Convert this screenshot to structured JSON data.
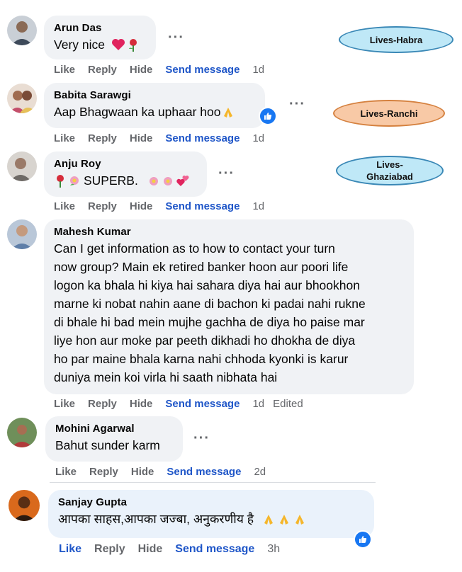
{
  "actions": {
    "like": "Like",
    "reply": "Reply",
    "hide": "Hide",
    "send": "Send message",
    "edited": "Edited"
  },
  "tags": [
    "Lives-Habra",
    "Lives-Ranchi",
    "Lives-Ghaziabad"
  ],
  "tag3_lines": [
    "Lives-",
    "Ghaziabad"
  ],
  "comments": [
    {
      "name": "Arun Das",
      "text": "Very nice",
      "time": "1d",
      "emoji": [
        "red-heart",
        "rose"
      ]
    },
    {
      "name": "Babita Sarawgi",
      "text": "Aap Bhagwaan ka uphaar hoo",
      "time": "1d",
      "emoji": [
        "folded-hands"
      ],
      "reaction": "like"
    },
    {
      "name": "Anju Roy",
      "text": "SUPERB.",
      "time": "1d",
      "emoji": [
        "rose",
        "flowers",
        "flowers",
        "flowers",
        "hearts"
      ]
    },
    {
      "name": "Mahesh Kumar",
      "lines": [
        "Can I get information as to how to contact your turn",
        "now group? Main ek retired banker hoon aur poori life",
        "logon ka bhala hi kiya hai sahara diya hai aur bhookhon",
        "marne ki nobat nahin aane di bachon ki padai nahi rukne",
        "di bhale hi bad mein mujhe gachha de diya ho paise mar",
        "liye hon aur moke par peeth dikhadi ho dhokha de diya",
        "ho par maine bhala karna nahi chhoda kyonki is karur",
        "duniya mein koi virla hi saath nibhata hai"
      ],
      "time": "1d",
      "edited": true
    },
    {
      "name": "Mohini Agarwal",
      "text": "Bahut sunder karm",
      "time": "2d"
    },
    {
      "name": "Sanjay Gupta",
      "text": "आपका साहस,आपका जज्बा, अनुकरणीय है",
      "time": "3h",
      "emoji": [
        "folded-hands",
        "folded-hands",
        "folded-hands"
      ],
      "reaction": "like"
    }
  ]
}
